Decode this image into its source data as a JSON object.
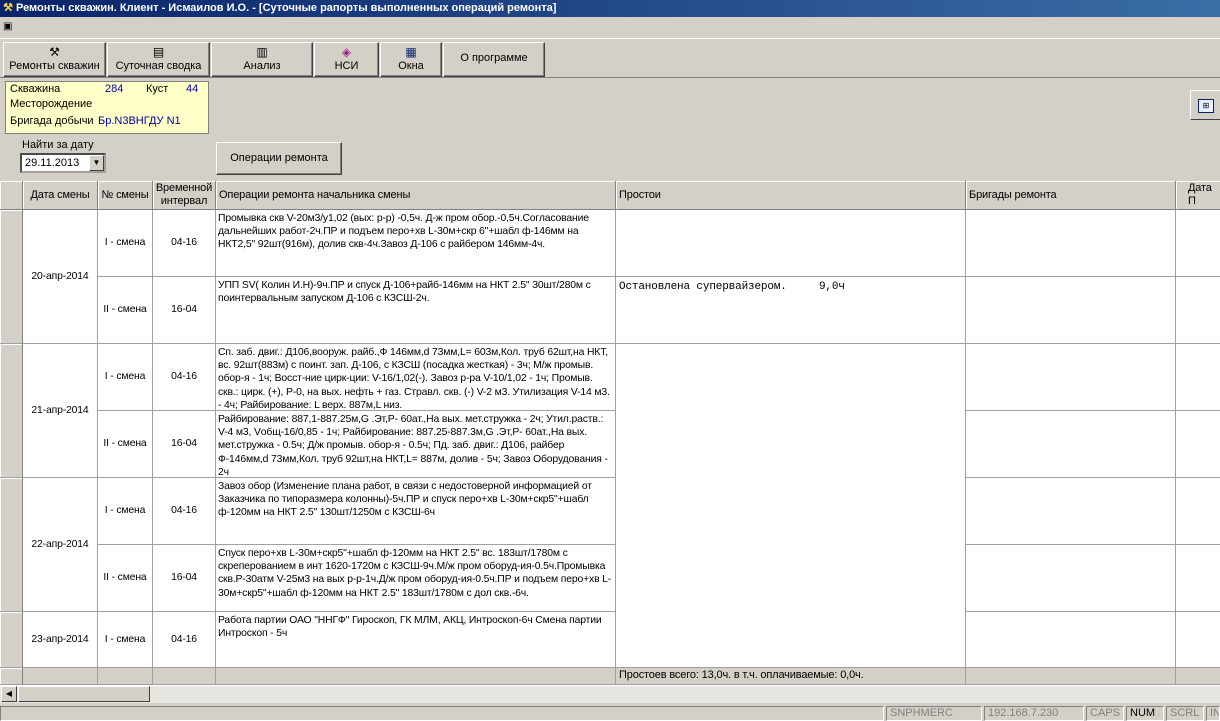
{
  "window": {
    "title": "Ремонты скважин. Клиент - Исмаилов И.О.   - [Суточные рапорты выполненных операций ремонта]"
  },
  "toolbar": [
    {
      "label": "Ремонты скважин",
      "icon": "hammer-icon",
      "glyph": "⚒"
    },
    {
      "label": "Суточная сводка",
      "icon": "report-icon",
      "glyph": "▤"
    },
    {
      "label": "Анализ",
      "icon": "book-icon",
      "glyph": "▥"
    },
    {
      "label": "НСИ",
      "icon": "books-icon",
      "glyph": "◈"
    },
    {
      "label": "Окна",
      "icon": "windows-icon",
      "glyph": "▦"
    },
    {
      "label": "О программе",
      "icon": "",
      "glyph": ""
    }
  ],
  "info": {
    "well_label": "Скважина",
    "well_value": "284",
    "cluster_label": "Куст",
    "cluster_value": "44",
    "field_label": "Месторождение",
    "brigade_label": "Бригада добычи",
    "brigade_value": "Бр.N3ВНГДУ N1"
  },
  "filter": {
    "label": "Найти за дату",
    "date": "29.11.2013",
    "operations_button": "Операции  ремонта"
  },
  "table": {
    "headers": {
      "date": "Дата смены",
      "shift": "№ смены",
      "interval": "Временной интервал",
      "ops": "Операции ремонта начальника смены",
      "downtime": "Простои",
      "brigades": "Бригады ремонта",
      "date2": "Дата П"
    },
    "dates": [
      "20-апр-2014",
      "21-апр-2014",
      "22-апр-2014",
      "23-апр-2014"
    ],
    "rows": [
      {
        "shift": "I - смена",
        "interval": "04-16",
        "ops": "Промывка скв V-20м3/у1,02 (вых: р-р) -0,5ч. Д-ж пром обор.-0,5ч.Согласование дальнейших работ-2ч.ПР и подъем перо+хв L-30м+скр 6\"+шабл ф-146мм на НКТ2,5\"  92шт(916м), долив скв-4ч.Завоз Д-106 с райбером 146мм-4ч.",
        "downtime": ""
      },
      {
        "shift": "II - смена",
        "interval": "16-04",
        "ops": "УПП SV( Колин И.Н)-9ч.ПР и спуск Д-106+райб-146мм на НКТ 2.5\" 30шт/280м с поинтервальным запуском Д-106 с КЗСШ-2ч.",
        "downtime": "Остановлена супервайзером.     9,0ч"
      },
      {
        "shift": "I - смена",
        "interval": "04-16",
        "ops": "Сп. заб. двиг.: Д106,вооруж. райб.,Ф 146мм,d 73мм,L= 603м,Кол. труб 62шт,на НКТ, вс. 92шт(883м) с поинт. зап. Д-106, с КЗСШ (посадка жесткая) - 3ч; М/ж промыв. обор-я - 1ч; Восст-ние цирк-ции: V-16/1,02(-). Завоз р-ра V-10/1,02 - 1ч; Промыв. скв.: цирк. (+), Р-0, на вых. нефть + газ. Стравл. скв. (-) V-2 м3. Утилизация V-14 м3. - 4ч; Райбирование: L верх. 887м,L низ.",
        "downtime": ""
      },
      {
        "shift": "II - смена",
        "interval": "16-04",
        "ops": "Райбирование: 887,1-887.25м,G .Эт,Р- 60ат.,На вых. мет.стружка - 2ч; Утил.раств.: V-4 м3, Vобщ-16/0,85 - 1ч; Райбирование: 887.25-887.3м,G .Эт,Р- 60ат.,На вых. мет.стружка - 0.5ч; Д/ж промыв. обор-я - 0.5ч; Пд. заб. двиг.: Д106, райбер Ф-146мм,d 73мм,Кол. труб 92шт,на НКТ,L= 887м, долив - 5ч; Завоз Оборудования - 2ч",
        "downtime": ""
      },
      {
        "shift": "I - смена",
        "interval": "04-16",
        "ops": "Завоз обор (Изменение плана работ, в связи с недостоверной информацией от Заказчика по типоразмера колонны)-5ч.ПР и спуск перо+хв L-30м+скр5\"+шабл ф-120мм на НКТ 2.5\" 130шт/1250м с КЗСШ-6ч",
        "downtime": ""
      },
      {
        "shift": "II - смена",
        "interval": "16-04",
        "ops": "Спуск перо+хв L-30м+скр5\"+шабл ф-120мм на НКТ 2.5\" вс. 183шт/1780м с скреперованием в инт 1620-1720м с КЗСШ-9ч.М/ж пром оборуд-ия-0.5ч.Промывка скв.Р-30атм V-25м3 на вых р-р-1ч.Д/ж пром оборуд-ия-0.5ч.ПР и подъем перо+хв L-30м+скр5\"+шабл ф-120мм на НКТ 2.5\" 183шт/1780м с дол скв.-6ч.",
        "downtime": ""
      },
      {
        "shift": "I - смена",
        "interval": "04-16",
        "ops": "Работа партии ОАО  \"ННГФ\" Гироскоп, ГК МЛМ, АКЦ, Интроскоп-6ч Смена партии Интроскоп - 5ч",
        "downtime": ""
      }
    ],
    "total": "Простоев всего: 13,0ч.   в т.ч. оплачиваемые: 0,0ч."
  },
  "status": [
    "SNPHMERC",
    "192.168.7.230",
    "CAPS",
    "NUM",
    "SCRL",
    "INS"
  ]
}
